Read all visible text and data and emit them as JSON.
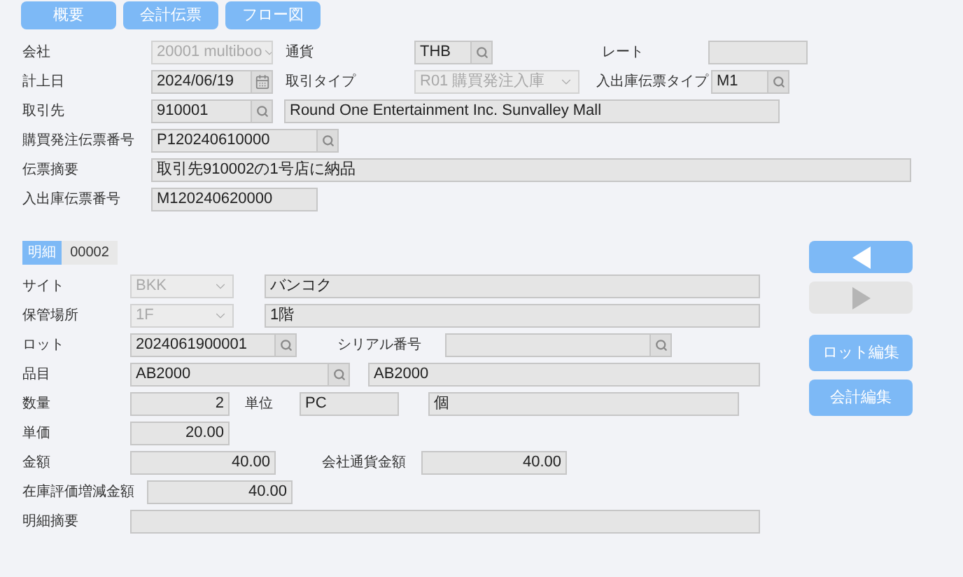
{
  "top_tabs": [
    {
      "label": "概要"
    },
    {
      "label": "会計伝票"
    },
    {
      "label": "フロー図"
    }
  ],
  "header_rows": [
    {
      "fields": [
        {
          "label": "会社",
          "kind": "select",
          "value": "20001 multiboo",
          "disabled": true
        },
        {
          "label": "通貨",
          "kind": "lookup",
          "value": "THB"
        },
        {
          "label": "レート",
          "kind": "text"
        }
      ]
    },
    {
      "fields": [
        {
          "label": "計上日",
          "kind": "date",
          "value": "2024/06/19"
        },
        {
          "label": "取引タイプ",
          "kind": "select",
          "value": "R01 購買発注入庫",
          "disabled": true
        },
        {
          "label": "入出庫伝票タイプ",
          "kind": "lookup",
          "value": "M1"
        }
      ]
    },
    {
      "fields": [
        {
          "label": "取引先",
          "kind": "lookup",
          "value": "910001"
        },
        {
          "kind": "text",
          "value": "Round One Entertainment Inc. Sunvalley Mall"
        }
      ]
    },
    {
      "fields": [
        {
          "label": "購買発注伝票番号",
          "kind": "lookup",
          "value": "P120240610000"
        }
      ]
    },
    {
      "fields": [
        {
          "label": "伝票摘要",
          "kind": "text",
          "value": "取引先910002の1号店に納品"
        }
      ]
    },
    {
      "fields": [
        {
          "label": "入出庫伝票番号",
          "kind": "text",
          "value": "M120240620000"
        }
      ]
    }
  ],
  "detail_tab": {
    "label": "明細",
    "selected": true,
    "number": "00002"
  },
  "detail_rows": [
    {
      "fields": [
        {
          "label": "サイト",
          "kind": "select",
          "value": "BKK",
          "disabled": true
        },
        {
          "kind": "text",
          "value": "バンコク"
        }
      ]
    },
    {
      "fields": [
        {
          "label": "保管場所",
          "kind": "select",
          "value": "1F",
          "disabled": true
        },
        {
          "kind": "text",
          "value": "1階"
        }
      ]
    },
    {
      "fields": [
        {
          "label": "ロット",
          "kind": "lookup",
          "value": "2024061900001"
        },
        {
          "label": "シリアル番号",
          "kind": "lookup"
        }
      ]
    },
    {
      "fields": [
        {
          "label": "品目",
          "kind": "lookup",
          "value": "AB2000"
        },
        {
          "kind": "text",
          "value": "AB2000"
        }
      ]
    },
    {
      "fields": [
        {
          "label": "数量",
          "kind": "number",
          "value": "2"
        },
        {
          "label": "単位",
          "kind": "text",
          "value": "PC"
        },
        {
          "kind": "text",
          "value": "個"
        }
      ]
    },
    {
      "fields": [
        {
          "label": "単価",
          "kind": "number",
          "value": "20.00"
        }
      ]
    },
    {
      "fields": [
        {
          "label": "金額",
          "kind": "number",
          "value": "40.00"
        },
        {
          "label": "会社通貨金額",
          "kind": "number",
          "value": "40.00"
        }
      ]
    },
    {
      "fields": [
        {
          "label": "在庫評価増減金額",
          "kind": "number",
          "value": "40.00"
        }
      ]
    },
    {
      "fields": [
        {
          "label": "明細摘要",
          "kind": "text"
        }
      ]
    }
  ],
  "nav_buttons": [
    {
      "kind": "prev",
      "disabled": false
    },
    {
      "kind": "next",
      "disabled": true
    }
  ],
  "action_buttons": [
    {
      "label": "ロット編集"
    },
    {
      "label": "会計編集"
    }
  ]
}
